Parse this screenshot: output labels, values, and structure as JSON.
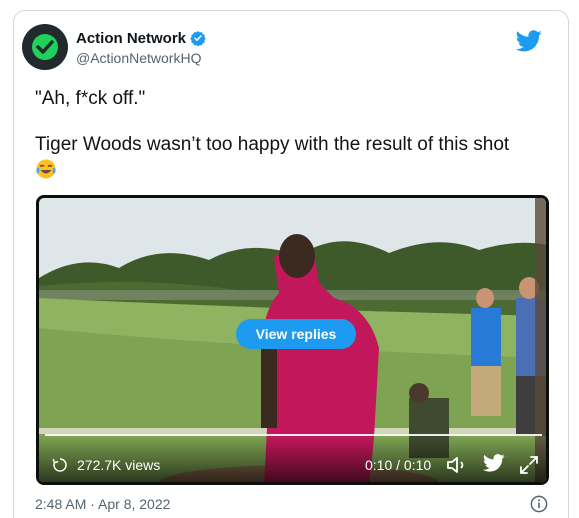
{
  "account": {
    "name": "Action Network",
    "handle": "@ActionNetworkHQ",
    "verified": true
  },
  "tweet": {
    "quote": "\"Ah, f*ck off.\"",
    "caption": "Tiger Woods wasn’t too happy with the result of this shot",
    "emoji": "face-with-tears-of-joy"
  },
  "video": {
    "replies_button": "View replies",
    "views": "272.7K views",
    "time": "0:10 / 0:10",
    "progress": 1.0
  },
  "footer": {
    "timestamp": "2:48 AM · Apr 8, 2022"
  },
  "colors": {
    "accent": "#1d9bf0",
    "avatar_check": "#1fd15b",
    "secondary_text": "#536471"
  }
}
